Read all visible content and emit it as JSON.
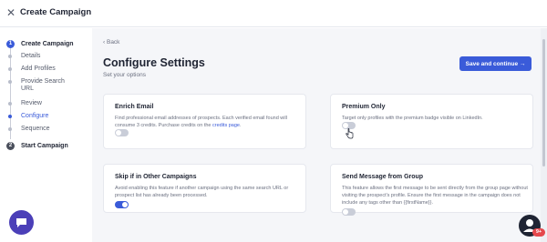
{
  "header": {
    "title": "Create Campaign"
  },
  "sidebar": {
    "steps": [
      {
        "number": "1",
        "label": "Create Campaign"
      },
      {
        "number": "2",
        "label": "Start Campaign"
      }
    ],
    "substeps": [
      {
        "label": "Details"
      },
      {
        "label": "Add Profiles"
      },
      {
        "label": "Provide Search URL"
      },
      {
        "label": "Review"
      },
      {
        "label": "Configure"
      },
      {
        "label": "Sequence"
      }
    ],
    "active_substep": "Configure"
  },
  "main": {
    "back_label": "Back",
    "title": "Configure Settings",
    "subtitle": "Set your options",
    "save_button_label": "Save and continue →"
  },
  "cards": [
    {
      "title": "Enrich Email",
      "description": "Find professional email addresses of prospects. Each verified email found will consume 3 credits. Purchase credits on the",
      "link_text": "credits page",
      "link_suffix": ".",
      "enabled": false
    },
    {
      "title": "Premium Only",
      "description": "Target only profiles with the premium badge visible on LinkedIn.",
      "enabled": false
    },
    {
      "title": "Skip if in Other Campaigns",
      "description": "Avoid enabling this feature if another campaign using the same search URL or prospect list has already been processed.",
      "enabled": true
    },
    {
      "title": "Send Message from Group",
      "description": "This feature allows the first message to be sent directly from the group page without visiting the prospect's profile. Ensure the first message in the campaign does not include any tags other than {{firstName}}.",
      "enabled": false
    }
  ],
  "notification_badge": "9+",
  "colors": {
    "accent": "#3a5bd9",
    "chat": "#4b3fb8",
    "badge": "#e5484d"
  }
}
